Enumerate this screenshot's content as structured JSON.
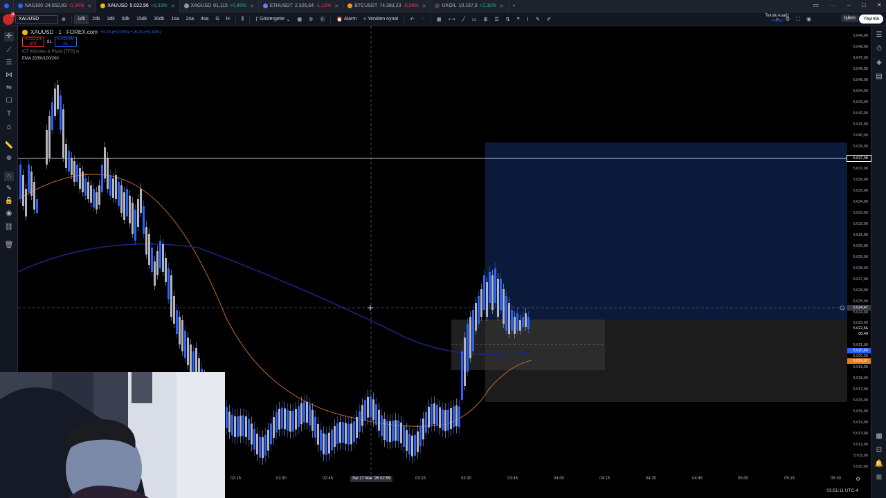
{
  "tabs": [
    {
      "symbol": "NAS100",
      "price": "24.552,83",
      "change": "-0,34%",
      "dir": "down",
      "color": "#2962ff"
    },
    {
      "symbol": "XAUUSD",
      "price": "5.022,56",
      "change": "+0,33%",
      "dir": "up",
      "color": "#f0b90b"
    },
    {
      "symbol": "XAGUSD",
      "price": "81,115",
      "change": "+0,45%",
      "dir": "up",
      "color": "#9598a1"
    },
    {
      "symbol": "ETHUSDT",
      "price": "2.326,64",
      "change": "-1,13%",
      "dir": "down",
      "color": "#627eea"
    },
    {
      "symbol": "BTCUSDT",
      "price": "74.283,23",
      "change": "-0,96%",
      "dir": "down",
      "color": "#f7931a"
    },
    {
      "symbol": "UKOIL",
      "price": "10.157,6",
      "change": "+2,38%",
      "dir": "up",
      "color": "#2a2e39"
    }
  ],
  "toolbar": {
    "symbol": "XAUUSD",
    "intervals": [
      "1dk",
      "2dk",
      "3dk",
      "5dk",
      "15dk",
      "30dk",
      "1sa",
      "2sa",
      "4sa",
      "G",
      "H"
    ],
    "active_interval": "1dk",
    "indicators": "Göstergeler",
    "alarm": "Alarm",
    "replay": "Yeniden oynat",
    "tech_analysis": "Teknik Analiz",
    "tech_sub": "Faydalı",
    "trade": "İşlem",
    "publish": "Yayınla",
    "notif_count": "11"
  },
  "legend": {
    "title": "XAUUSD · 1 · FOREX.com",
    "change": "+0,23 (+0,00%) +16,29 (+0,32%)",
    "bid": "5.022,14",
    "bid_label": "SAT",
    "spread": "81",
    "ask": "5.022,95",
    "ask_label": "AL",
    "ict": "ICT Killzones & Pivots [TFO]",
    "ema": "EMA 20/50/100/200"
  },
  "price_axis": {
    "labels": [
      "5.049,00",
      "5.048,00",
      "5.047,00",
      "5.046,00",
      "5.045,00",
      "5.044,00",
      "5.043,00",
      "5.042,00",
      "5.041,00",
      "5.040,00",
      "5.039,00",
      "5.038,00",
      "5.037,00",
      "5.036,00",
      "5.035,00",
      "5.034,00",
      "5.033,00",
      "5.032,00",
      "5.031,00",
      "5.030,00",
      "5.029,00",
      "5.028,00",
      "5.027,00",
      "5.026,00",
      "5.025,00",
      "5.024,00",
      "5.023,00",
      "5.022,00",
      "5.021,00",
      "5.020,00",
      "5.019,00",
      "5.018,00",
      "5.017,00",
      "5.016,00",
      "5.015,00",
      "5.014,00",
      "5.013,00",
      "5.012,00",
      "5.011,00",
      "5.010,00"
    ],
    "hline_price": "5.037,98",
    "cursor_price": "5.024,47",
    "last_price": "5.022,56",
    "countdown": "00:49",
    "blue_tag": "5.020,60",
    "orange_tag": "5.019,67"
  },
  "time_axis": {
    "labels": [
      "02:15",
      "02:30",
      "02:45",
      "03:15",
      "03:30",
      "03:45",
      "04:00",
      "04:15",
      "04:30",
      "04:45",
      "05:00",
      "05:15",
      "05:30"
    ],
    "cursor_label": "Sal 17 Mar '26  02:59"
  },
  "clock": "03:51:11 UTC-4",
  "colors": {
    "up_candle": "#2962ff",
    "down_candle": "#b2b5be",
    "ema_orange": "#c76a2a",
    "ema_blue": "#1a237e",
    "zone_blue": "#0b1a3a",
    "zone_grey": "#2a2a2a"
  }
}
